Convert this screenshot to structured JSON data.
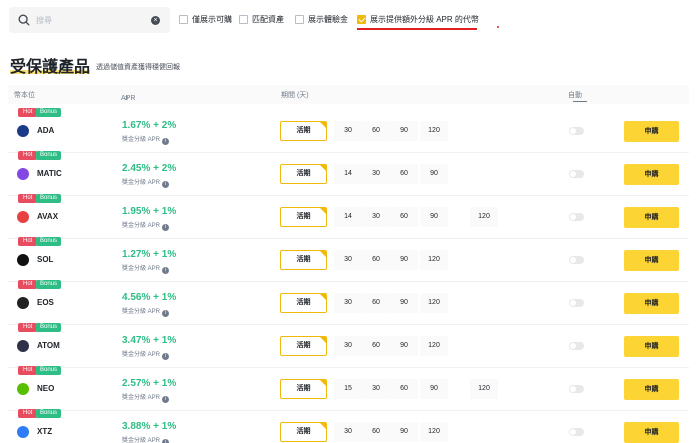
{
  "search": {
    "placeholder": "搜尋",
    "clear_icon": "close-circle-icon"
  },
  "filters": [
    {
      "label": "僅展示可購",
      "checked": false
    },
    {
      "label": "匹配資產",
      "checked": false
    },
    {
      "label": "展示體驗金",
      "checked": false
    },
    {
      "label": "展示提供額外分級 APR 的代幣",
      "checked": true
    }
  ],
  "heading": {
    "title": "受保護產品",
    "subtitle": "透過儲值資產獲得穩健回報"
  },
  "table": {
    "headers": {
      "coin": "幣本位",
      "apr": "APR",
      "period": "期間 (天)",
      "auto": "自動"
    },
    "sort_icon": "sort-icon",
    "badges": {
      "hot": "Hot",
      "bonus": "Bonus"
    },
    "apr_sub": "獎金分級 APR",
    "active_label": "活期",
    "subscribe_label": "申購",
    "rows": [
      {
        "coin": "ADA",
        "color": "#1a3a8a",
        "apr": "1.67% + 2%",
        "periods": [
          "30",
          "60",
          "90",
          "120"
        ]
      },
      {
        "coin": "MATIC",
        "color": "#8247e5",
        "apr": "2.45% + 2%",
        "periods": [
          "14",
          "30",
          "60",
          "90"
        ]
      },
      {
        "coin": "AVAX",
        "color": "#e84142",
        "apr": "1.95% + 1%",
        "periods": [
          "14",
          "30",
          "60",
          "90",
          "120"
        ]
      },
      {
        "coin": "SOL",
        "color": "#111111",
        "apr": "1.27% + 1%",
        "periods": [
          "30",
          "60",
          "90",
          "120"
        ]
      },
      {
        "coin": "EOS",
        "color": "#222222",
        "apr": "4.56% + 1%",
        "periods": [
          "30",
          "60",
          "90",
          "120"
        ]
      },
      {
        "coin": "ATOM",
        "color": "#2e3148",
        "apr": "3.47% + 1%",
        "periods": [
          "30",
          "60",
          "90",
          "120"
        ]
      },
      {
        "coin": "NEO",
        "color": "#58bf00",
        "apr": "2.57% + 1%",
        "periods": [
          "15",
          "30",
          "60",
          "90",
          "120"
        ]
      },
      {
        "coin": "XTZ",
        "color": "#2c7df7",
        "apr": "3.88% + 1%",
        "periods": [
          "30",
          "60",
          "90",
          "120"
        ]
      }
    ]
  },
  "colors": {
    "accent": "#fcd535",
    "positive": "#2ebd85",
    "hot": "#e74c5f",
    "annotation": "#e02020"
  }
}
